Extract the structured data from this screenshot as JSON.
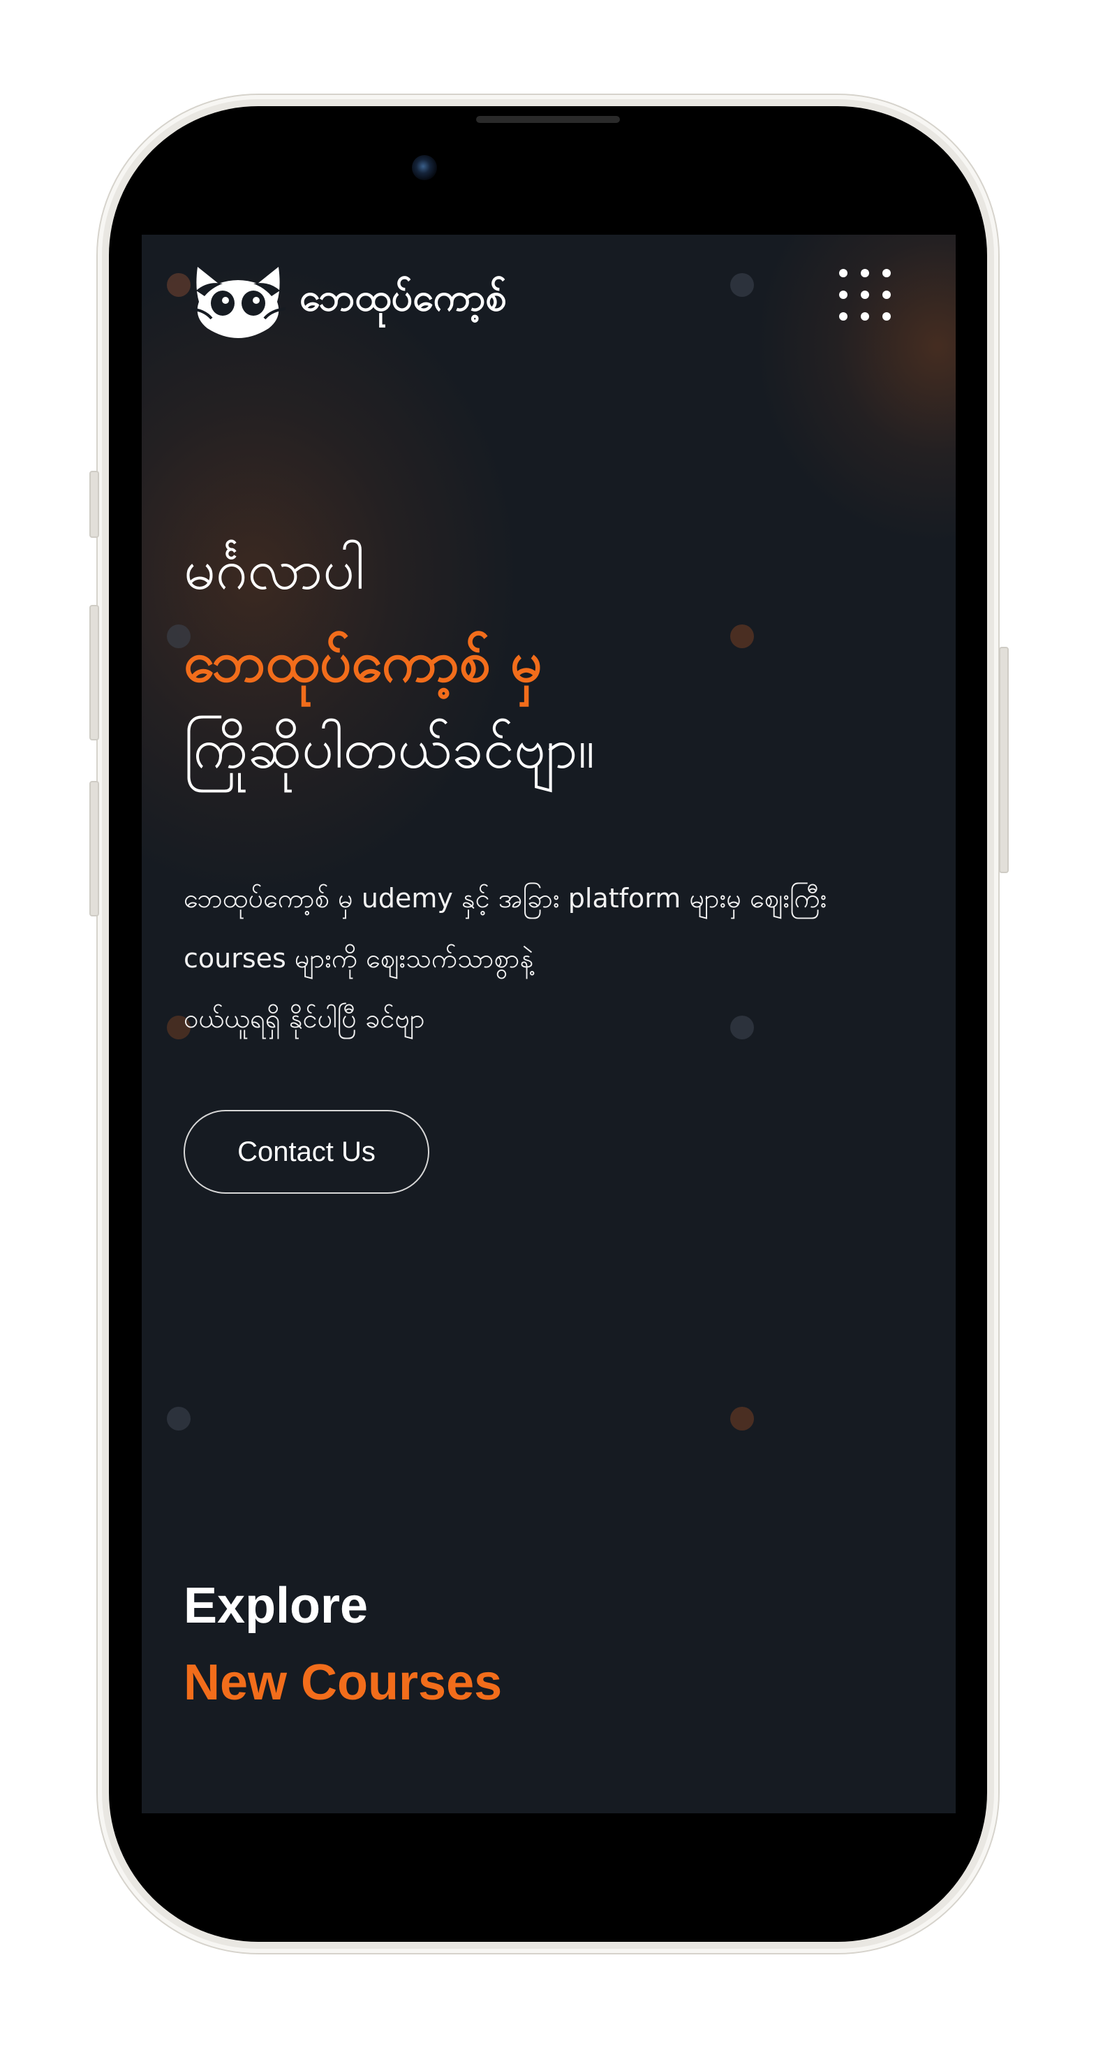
{
  "colors": {
    "accent": "#f26d1b",
    "background": "#161b22",
    "text": "#ffffff"
  },
  "navbar": {
    "logo_icon": "cat-face-icon",
    "logo_text": "ဘေထုပ်ကော့စ်",
    "menu_icon": "grid-menu-icon"
  },
  "hero": {
    "line1": "မင်္ဂလာပါ",
    "line2": "ဘေထုပ်ကော့စ် မှ",
    "line3": "ကြိုဆိုပါတယ်ခင်ဗျာ။",
    "description": [
      "ဘေထုပ်ကော့စ် မှ udemy နှင့် အခြား platform များမှ ဈေးကြီး",
      "courses များကို ဈေးသက်သာစွာနဲ့",
      "ဝယ်ယူရရှိ နိုင်ပါပြီ ခင်ဗျာ"
    ],
    "contact_button": "Contact Us"
  },
  "explore": {
    "line1": "Explore",
    "line2": "New Courses"
  }
}
